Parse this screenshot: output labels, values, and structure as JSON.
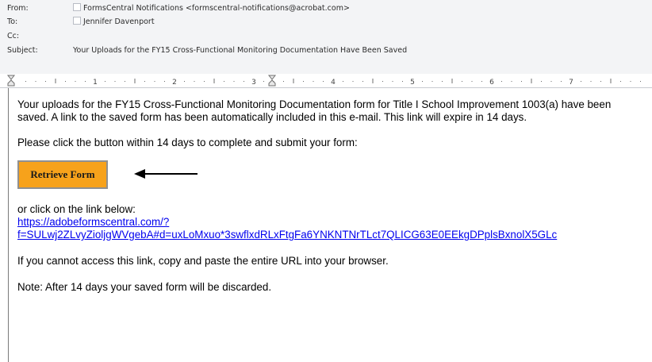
{
  "header": {
    "from_label": "From:",
    "from_value": "FormsCentral Notifications <formscentral-notifications@acrobat.com>",
    "to_label": "To:",
    "to_value": "Jennifer Davenport",
    "cc_label": "Cc:",
    "subject_label": "Subject:",
    "subject_value": "Your Uploads for the FY15 Cross-Functional Monitoring Documentation  Have Been Saved"
  },
  "ruler": {
    "numbers": [
      "1",
      "2",
      "3",
      "4",
      "5",
      "6",
      "7"
    ]
  },
  "body": {
    "intro": "Your uploads for the FY15 Cross-Functional Monitoring Documentation form for Title I School Improvement 1003(a) have been saved.  A link to the saved form has been automatically included in this e-mail.  This link will expire in 14 days.",
    "instruction": "Please click the button within 14 days to complete and submit your form:",
    "button_label": "Retrieve Form",
    "button_color": "#f7a21b",
    "or_click": "or click on the link below:",
    "link_line1": "https://adobeformscentral.com/?",
    "link_line2": "f=SULwj2ZLvyZioljgWVgebA#d=uxLoMxuo*3swflxdRLxFtgFa6YNKNTNrTLct7QLICG63E0EEkgDPplsBxnolX5GLc",
    "cannot_access": "If you cannot access this link, copy and paste the entire URL into your browser.",
    "note": "Note: After 14 days your saved form will be discarded."
  },
  "colors": {
    "link": "#0000ee",
    "header_bg": "#f3f4f6"
  }
}
